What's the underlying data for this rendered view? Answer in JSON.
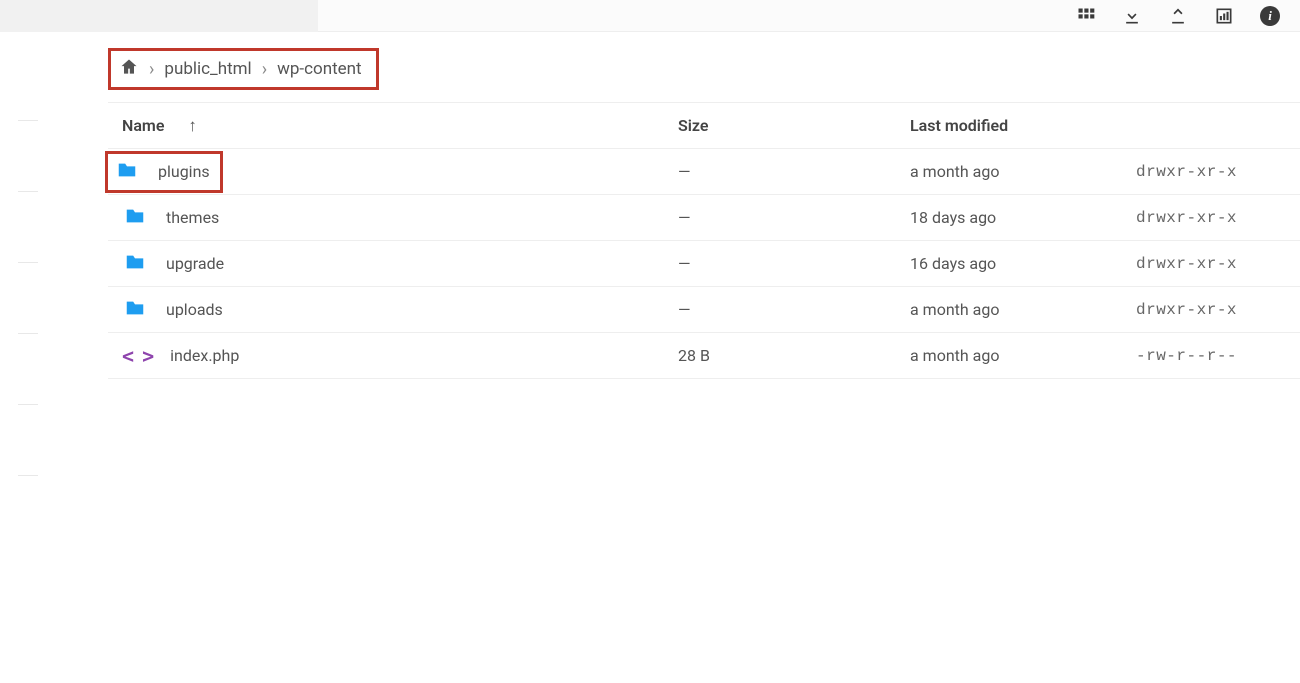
{
  "breadcrumb": {
    "items": [
      "public_html",
      "wp-content"
    ]
  },
  "columns": {
    "name": "Name",
    "size": "Size",
    "modified": "Last modified"
  },
  "rows": [
    {
      "type": "folder",
      "name": "plugins",
      "size": "—",
      "modified": "a month ago",
      "perm": "drwxr-xr-x",
      "highlight": true
    },
    {
      "type": "folder",
      "name": "themes",
      "size": "—",
      "modified": "18 days ago",
      "perm": "drwxr-xr-x"
    },
    {
      "type": "folder",
      "name": "upgrade",
      "size": "—",
      "modified": "16 days ago",
      "perm": "drwxr-xr-x"
    },
    {
      "type": "folder",
      "name": "uploads",
      "size": "—",
      "modified": "a month ago",
      "perm": "drwxr-xr-x"
    },
    {
      "type": "file",
      "name": "index.php",
      "size": "28 B",
      "modified": "a month ago",
      "perm": "-rw-r--r--"
    }
  ]
}
